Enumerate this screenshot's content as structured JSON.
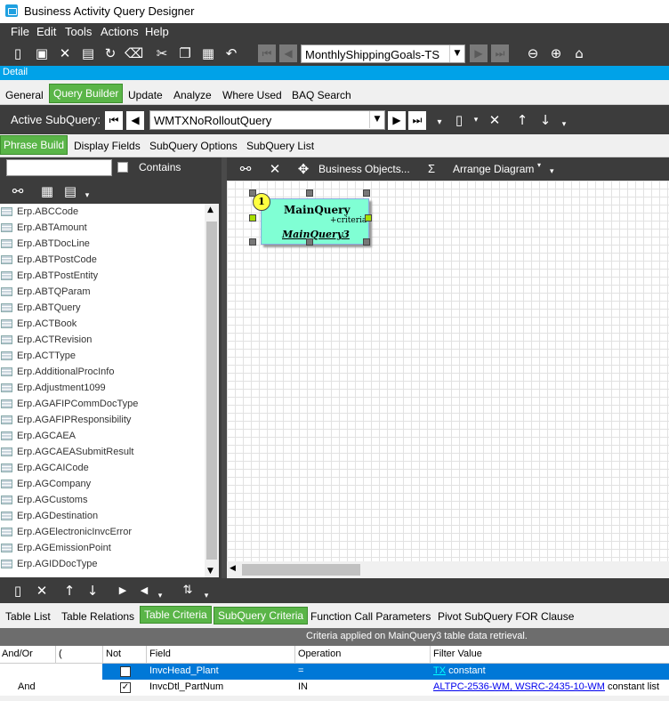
{
  "window": {
    "title": "Business Activity Query Designer"
  },
  "menu": [
    "File",
    "Edit",
    "Tools",
    "Actions",
    "Help"
  ],
  "toolbar": {
    "query_id": "MonthlyShippingGoals-TS"
  },
  "detail_label": "Detail",
  "main_tabs": [
    "General",
    "Query Builder",
    "Update",
    "Analyze",
    "Where Used",
    "BAQ Search"
  ],
  "main_tabs_active": "Query Builder",
  "subquery": {
    "label": "Active SubQuery:",
    "value": "WMTXNoRolloutQuery"
  },
  "builder_tabs": [
    "Phrase Build",
    "Display Fields",
    "SubQuery Options",
    "SubQuery List"
  ],
  "builder_tabs_active": "Phrase Build",
  "search": {
    "value": "",
    "contains_label": "Contains"
  },
  "tables": [
    "Erp.ABCCode",
    "Erp.ABTAmount",
    "Erp.ABTDocLine",
    "Erp.ABTPostCode",
    "Erp.ABTPostEntity",
    "Erp.ABTQParam",
    "Erp.ABTQuery",
    "Erp.ACTBook",
    "Erp.ACTRevision",
    "Erp.ACTType",
    "Erp.AdditionalProcInfo",
    "Erp.Adjustment1099",
    "Erp.AGAFIPCommDocType",
    "Erp.AGAFIPResponsibility",
    "Erp.AGCAEA",
    "Erp.AGCAEASubmitResult",
    "Erp.AGCAICode",
    "Erp.AGCompany",
    "Erp.AGCustoms",
    "Erp.AGDestination",
    "Erp.AGElectronicInvcError",
    "Erp.AGEmissionPoint",
    "Erp.AGIDDocType"
  ],
  "diagram_tools": {
    "business_objects": "Business Objects...",
    "sigma": "Σ",
    "arrange": "Arrange Diagram"
  },
  "node": {
    "badge": "1",
    "title": "MainQuery",
    "criteria": "+criteria",
    "alias": "MainQuery3"
  },
  "bottom_tabs": [
    "Table List",
    "Table Relations",
    "Table Criteria",
    "SubQuery Criteria",
    "Function Call Parameters",
    "Pivot SubQuery FOR Clause"
  ],
  "bottom_tabs_active": [
    "Table Criteria",
    "SubQuery Criteria"
  ],
  "grid": {
    "caption": "Criteria applied on MainQuery3 table data retrieval.",
    "headers": [
      "And/Or",
      "(",
      "Not",
      "Field",
      "Operation",
      "Filter Value"
    ],
    "rows": [
      {
        "andor": "",
        "paren": "",
        "not": false,
        "field": "InvcHead_Plant",
        "operation": "=",
        "filter_link": "TX",
        "filter_type": "constant",
        "selected": true
      },
      {
        "andor": "And",
        "paren": "",
        "not": true,
        "field": "InvcDtl_PartNum",
        "operation": "IN",
        "filter_link": "ALTPC-2536-WM, WSRC-2435-10-WM",
        "filter_type": "constant list",
        "selected": false
      }
    ]
  },
  "colors": {
    "accent_blue": "#00a2e8",
    "active_green": "#5ab548",
    "dark_toolbar": "#3c3c3c",
    "node_fill": "#80ffd4",
    "selection": "#0078d7"
  }
}
